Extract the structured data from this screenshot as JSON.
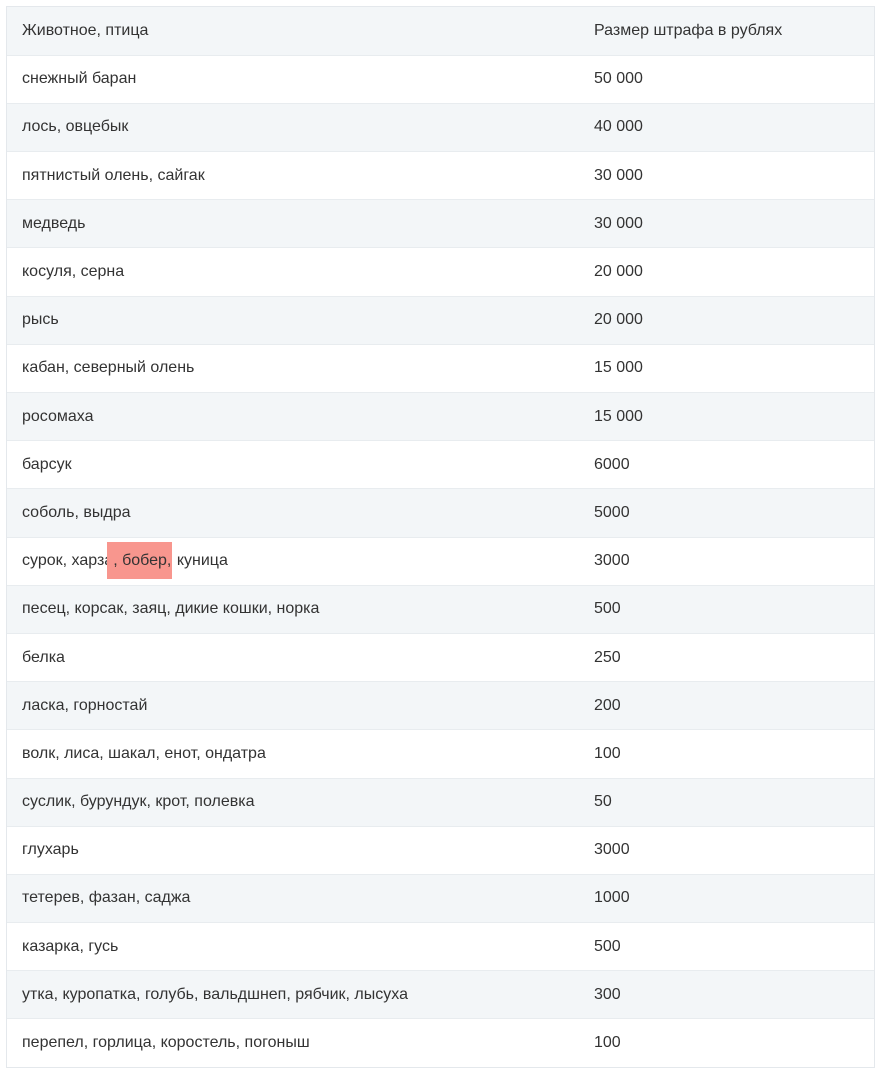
{
  "table": {
    "headers": [
      "Животное, птица",
      "Размер штрафа в рублях"
    ],
    "rows": [
      {
        "animal": "снежный баран",
        "fine": "50 000"
      },
      {
        "animal": "лось, овцебык",
        "fine": "40 000"
      },
      {
        "animal": "пятнистый олень, сайгак",
        "fine": "30 000"
      },
      {
        "animal": "медведь",
        "fine": "30 000"
      },
      {
        "animal": "косуля, серна",
        "fine": "20 000"
      },
      {
        "animal": "рысь",
        "fine": "20 000"
      },
      {
        "animal": "кабан, северный олень",
        "fine": "15 000"
      },
      {
        "animal": "росомаха",
        "fine": "15 000"
      },
      {
        "animal": "барсук",
        "fine": "6000"
      },
      {
        "animal": "соболь, выдра",
        "fine": "5000"
      },
      {
        "animal_parts": [
          "сурок, харза",
          ", бобер,",
          " куница"
        ],
        "fine": "3000"
      },
      {
        "animal": "песец, корсак, заяц, дикие кошки, норка",
        "fine": "500"
      },
      {
        "animal": "белка",
        "fine": "250"
      },
      {
        "animal": "ласка, горностай",
        "fine": "200"
      },
      {
        "animal": "волк, лиса, шакал, енот, ондатра",
        "fine": "100"
      },
      {
        "animal": "суслик, бурундук, крот, полевка",
        "fine": "50"
      },
      {
        "animal": "глухарь",
        "fine": "3000"
      },
      {
        "animal": "тетерев, фазан, саджа",
        "fine": "1000"
      },
      {
        "animal": "казарка, гусь",
        "fine": "500"
      },
      {
        "animal": "утка, куропатка, голубь, вальдшнеп, рябчик, лысуха",
        "fine": "300"
      },
      {
        "animal": "перепел, горлица, коростель, погоныш",
        "fine": "100"
      }
    ]
  },
  "colors": {
    "highlight": "#f8968e",
    "row_alt": "#f3f6f8",
    "border": "#e4e8ec"
  }
}
